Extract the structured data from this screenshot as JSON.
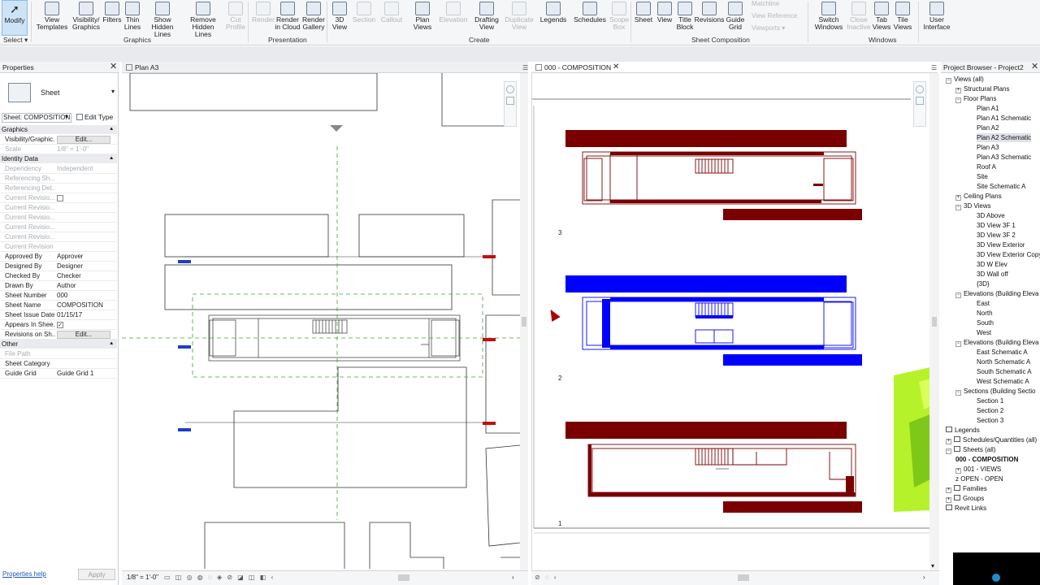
{
  "ribbon": {
    "modify": "Modify",
    "select": "Select ▾",
    "graphics_buttons": [
      "View\nTemplates",
      "Visibility/\nGraphics",
      "Filters",
      "Thin\nLines",
      "Show\nHidden Lines",
      "Remove\nHidden Lines",
      "Cut\nProfile"
    ],
    "presentation_buttons": [
      "Render",
      "Render\nin Cloud",
      "Render\nGallery"
    ],
    "create_buttons": [
      "3D\nView",
      "Section",
      "Callout",
      "Plan\nViews",
      "Elevation",
      "Drafting\nView",
      "Duplicate\nView",
      "Legends",
      "Schedules",
      "Scope\nBox"
    ],
    "sheet_buttons": [
      "Sheet",
      "View",
      "Title\nBlock",
      "Revisions",
      "Guide\nGrid"
    ],
    "sheet_small": [
      "Matchline",
      "View Reference",
      "Viewports ▾"
    ],
    "window_buttons": [
      "Switch\nWindows",
      "Close\nInactive",
      "Tab\nViews",
      "Tile\nViews"
    ],
    "ui_button": "User\nInterface",
    "groups": {
      "graphics": "Graphics",
      "presentation": "Presentation",
      "create": "Create",
      "sheet_composition": "Sheet Composition",
      "windows": "Windows"
    }
  },
  "properties": {
    "title": "Properties",
    "type_name": "Sheet",
    "selector": "Sheet: COMPOSITION",
    "edit_type": "Edit Type",
    "sections": {
      "graphics": "Graphics",
      "identity": "Identity Data",
      "other": "Other"
    },
    "graphics_rows": [
      {
        "k": "Visibility/Graphic...",
        "v": "Edit..."
      },
      {
        "k": "Scale",
        "v": "1/8\" = 1'-0\""
      }
    ],
    "identity_rows": [
      {
        "k": "Dependency",
        "v": "Independent"
      },
      {
        "k": "Referencing Sh...",
        "v": ""
      },
      {
        "k": "Referencing Det...",
        "v": ""
      },
      {
        "k": "Current Revisio...",
        "v": ""
      },
      {
        "k": "Current Revisio...",
        "v": ""
      },
      {
        "k": "Current Revisio...",
        "v": ""
      },
      {
        "k": "Current Revisio...",
        "v": ""
      },
      {
        "k": "Current Revisio...",
        "v": ""
      },
      {
        "k": "Current Revision",
        "v": ""
      },
      {
        "k": "Approved By",
        "v": "Approver"
      },
      {
        "k": "Designed By",
        "v": "Designer"
      },
      {
        "k": "Checked By",
        "v": "Checker"
      },
      {
        "k": "Drawn By",
        "v": "Author"
      },
      {
        "k": "Sheet Number",
        "v": "000"
      },
      {
        "k": "Sheet Name",
        "v": "COMPOSITION"
      },
      {
        "k": "Sheet Issue Date",
        "v": "01/15/17"
      },
      {
        "k": "Appears In Shee...",
        "v": ""
      },
      {
        "k": "Revisions on Sh...",
        "v": "Edit..."
      }
    ],
    "other_rows": [
      {
        "k": "File Path",
        "v": ""
      },
      {
        "k": "Sheet Category",
        "v": ""
      },
      {
        "k": "Guide Grid",
        "v": "Guide Grid 1"
      }
    ],
    "help_link": "Properties help",
    "apply": "Apply"
  },
  "views": {
    "left_tab": "Plan A3",
    "right_tab": "000 - COMPOSITION",
    "left_scale": "1/8\" = 1'-0\"",
    "viewport_numbers": [
      "3",
      "2",
      "1"
    ]
  },
  "browser": {
    "title": "Project Browser - Project2",
    "items": [
      {
        "label": "Views (all)",
        "level": 0,
        "toggle": "−"
      },
      {
        "label": "Structural Plans",
        "level": 1,
        "toggle": "+"
      },
      {
        "label": "Floor Plans",
        "level": 1,
        "toggle": "−"
      },
      {
        "label": "Plan A1",
        "level": 2
      },
      {
        "label": "Plan A1 Schematic",
        "level": 2
      },
      {
        "label": "Plan A2",
        "level": 2
      },
      {
        "label": "Plan A2 Schematic",
        "level": 2,
        "selected": true
      },
      {
        "label": "Plan A3",
        "level": 2
      },
      {
        "label": "Plan A3 Schematic",
        "level": 2
      },
      {
        "label": "Roof A",
        "level": 2
      },
      {
        "label": "Site",
        "level": 2
      },
      {
        "label": "Site Schematic A",
        "level": 2
      },
      {
        "label": "Ceiling Plans",
        "level": 1,
        "toggle": "+"
      },
      {
        "label": "3D Views",
        "level": 1,
        "toggle": "−"
      },
      {
        "label": "3D Above",
        "level": 2
      },
      {
        "label": "3D View 3F 1",
        "level": 2
      },
      {
        "label": "3D View 3F 2",
        "level": 2
      },
      {
        "label": "3D View Exterior",
        "level": 2
      },
      {
        "label": "3D View Exterior Copy",
        "level": 2
      },
      {
        "label": "3D W Elev",
        "level": 2
      },
      {
        "label": "3D Wall off",
        "level": 2
      },
      {
        "label": "{3D}",
        "level": 2
      },
      {
        "label": "Elevations (Building Eleva",
        "level": 1,
        "toggle": "−"
      },
      {
        "label": "East",
        "level": 2
      },
      {
        "label": "North",
        "level": 2
      },
      {
        "label": "South",
        "level": 2
      },
      {
        "label": "West",
        "level": 2
      },
      {
        "label": "Elevations (Building Eleva",
        "level": 1,
        "toggle": "−"
      },
      {
        "label": "East Schematic A",
        "level": 2
      },
      {
        "label": "North Schematic A",
        "level": 2
      },
      {
        "label": "South Schematic A",
        "level": 2
      },
      {
        "label": "West Schematic A",
        "level": 2
      },
      {
        "label": "Sections (Building Sectio",
        "level": 1,
        "toggle": "−"
      },
      {
        "label": "Section 1",
        "level": 2
      },
      {
        "label": "Section 2",
        "level": 2
      },
      {
        "label": "Section 3",
        "level": 2
      },
      {
        "label": "Legends",
        "level": 0,
        "icon": true
      },
      {
        "label": "Schedules/Quantities (all)",
        "level": 0,
        "toggle": "+",
        "icon": true
      },
      {
        "label": "Sheets (all)",
        "level": 0,
        "toggle": "−",
        "icon": true
      },
      {
        "label": "000 - COMPOSITION",
        "level": 1,
        "bold": true
      },
      {
        "label": "001 - VIEWS",
        "level": 1,
        "toggle": "+"
      },
      {
        "label": "z OPEN - OPEN",
        "level": 1
      },
      {
        "label": "Families",
        "level": 0,
        "toggle": "+",
        "icon": true
      },
      {
        "label": "Groups",
        "level": 0,
        "toggle": "+",
        "icon": true
      },
      {
        "label": "Revit Links",
        "level": 0,
        "icon": true
      }
    ]
  },
  "colors": {
    "dark_red": "#7a0000",
    "blue": "#0000ff",
    "lime": "#b6f22a",
    "guide_green": "#3aa53a"
  }
}
